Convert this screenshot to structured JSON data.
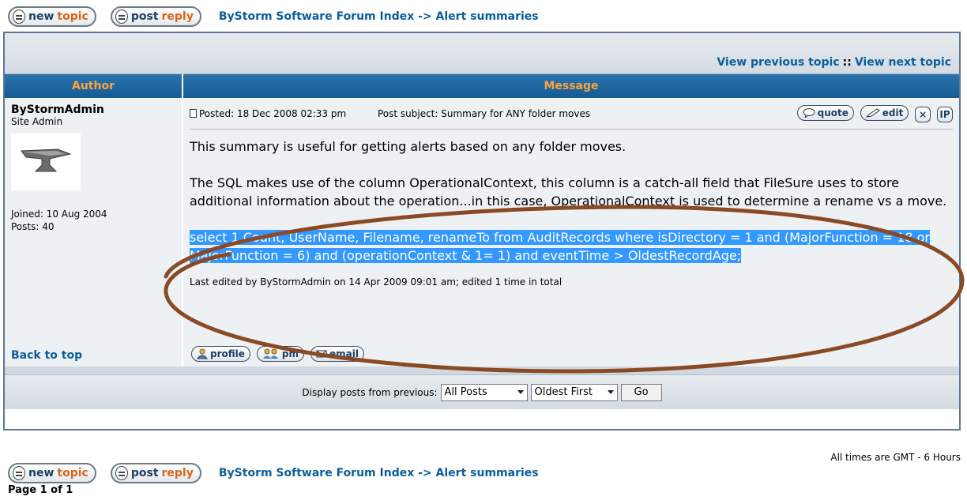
{
  "buttons": {
    "newtopic_a": "new",
    "newtopic_b": "topic",
    "postreply_a": "post",
    "postreply_b": "reply"
  },
  "breadcrumb": {
    "index": "ByStorm Software Forum Index",
    "sep": "->",
    "current": "Alert summaries"
  },
  "topic_nav": {
    "prev": "View previous topic",
    "sep": "::",
    "next": "View next topic"
  },
  "table": {
    "author_header": "Author",
    "message_header": "Message"
  },
  "post": {
    "author_name": "ByStormAdmin",
    "author_rank": "Site Admin",
    "joined": "Joined: 10 Aug 2004",
    "posts": "Posts: 40",
    "posted": "Posted: 18 Dec 2008 02:33 pm",
    "subject": "Post subject: Summary for ANY folder moves",
    "para1": "This summary is useful for getting alerts based on any folder moves.",
    "para2": "The SQL makes use of the column OperationalContext, this column is a catch-all field that FileSure uses to store additional information about the operation...in this case, OperationalContext is used to determine a rename vs a move.",
    "sql": "select 1 Count, UserName, Filename, renameTo from AuditRecords where isDirectory = 1 and (MajorFunction = 18 or MajorFunction = 6) and (operationContext & 1= 1) and eventTime > OldestRecordAge;",
    "edited": "Last edited by ByStormAdmin on 14 Apr 2009 09:01 am; edited 1 time in total"
  },
  "post_buttons": {
    "quote": "quote",
    "edit": "edit",
    "delete": "×",
    "ip": "IP",
    "profile": "profile",
    "pm": "pm",
    "email": "email"
  },
  "back_to_top": "Back to top",
  "display": {
    "label": "Display posts from previous:",
    "posts_select": "All Posts",
    "order_select": "Oldest First",
    "go": "Go"
  },
  "footer": {
    "timezone": "All times are GMT - 6 Hours",
    "page": "Page 1 of 1"
  },
  "colors": {
    "header_bg": "#1e66a2",
    "header_text": "#ffa53a",
    "link": "#0b5e9c",
    "highlight": "#3398ff",
    "annotation": "#8a4a26"
  }
}
